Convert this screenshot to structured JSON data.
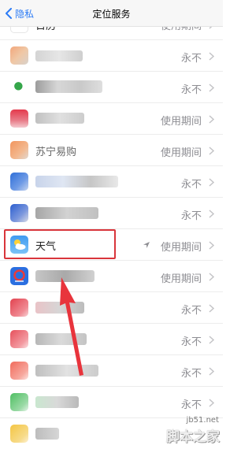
{
  "nav": {
    "back_label": "隐私",
    "title": "定位服务"
  },
  "rows": [
    {
      "name": "日历",
      "status": "使用期间",
      "icon": "calendar-icon"
    },
    {
      "name": "",
      "status": "永不",
      "icon": "app-icon"
    },
    {
      "name": "",
      "status": "永不",
      "icon": "app-icon"
    },
    {
      "name": "",
      "status": "使用期间",
      "icon": "app-icon"
    },
    {
      "name": "苏宁易购",
      "status": "使用期间",
      "icon": "app-icon"
    },
    {
      "name": "",
      "status": "永不",
      "icon": "app-icon"
    },
    {
      "name": "",
      "status": "永不",
      "icon": "app-icon"
    },
    {
      "name": "天气",
      "status": "使用期间",
      "icon": "weather-icon"
    },
    {
      "name": "",
      "status": "使用期间",
      "icon": "app-icon"
    },
    {
      "name": "",
      "status": "永不",
      "icon": "app-icon"
    },
    {
      "name": "",
      "status": "永不",
      "icon": "app-icon"
    },
    {
      "name": "",
      "status": "永不",
      "icon": "app-icon"
    },
    {
      "name": "",
      "status": "永不",
      "icon": "app-icon"
    },
    {
      "name": "",
      "status": "",
      "icon": "app-icon"
    }
  ],
  "watermark": {
    "site": "jb51.net",
    "name": "脚本之家"
  },
  "colors": {
    "accent": "#2d7cf6",
    "highlight": "#d9353b",
    "status": "#8e8e93"
  }
}
